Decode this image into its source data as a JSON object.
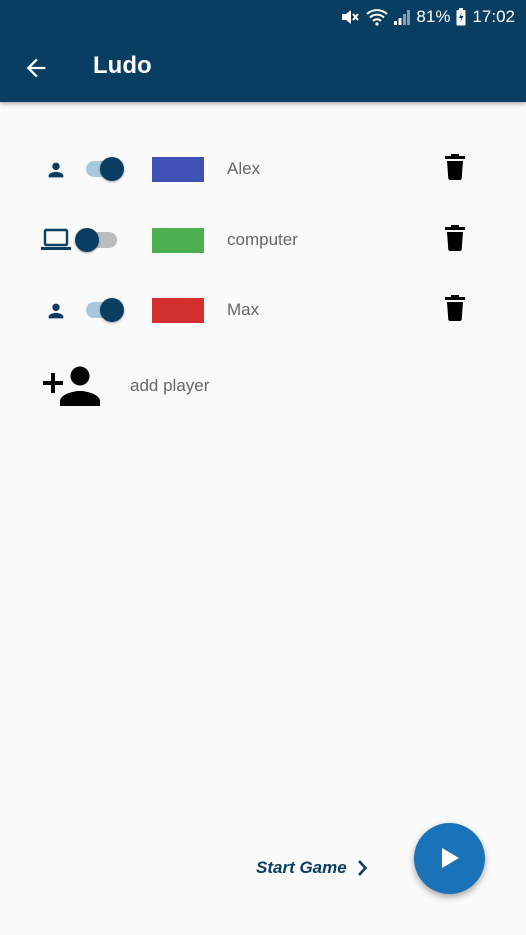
{
  "status_bar": {
    "battery": "81%",
    "time": "17:02",
    "icons": [
      "mute-icon",
      "wifi-icon",
      "signal-icon",
      "battery-icon"
    ]
  },
  "app_bar": {
    "title": "Ludo",
    "back_icon": "arrow-back-icon"
  },
  "players": [
    {
      "type": "human",
      "type_icon": "person-icon",
      "enabled": true,
      "color": "#3f51b5",
      "name": "Alex"
    },
    {
      "type": "computer",
      "type_icon": "laptop-icon",
      "enabled": false,
      "color": "#4caf50",
      "name": "computer"
    },
    {
      "type": "human",
      "type_icon": "person-icon",
      "enabled": true,
      "color": "#d32f2f",
      "name": "Max"
    }
  ],
  "add_player": {
    "label": "add player",
    "icon": "person-add-icon"
  },
  "start_game": {
    "label": "Start Game",
    "icon": "chevron-right-icon"
  },
  "fab": {
    "icon": "play-icon"
  },
  "colors": {
    "primary": "#0a3d62",
    "fab": "#1a72b8",
    "background": "#fafafa",
    "text_secondary": "#666666"
  }
}
